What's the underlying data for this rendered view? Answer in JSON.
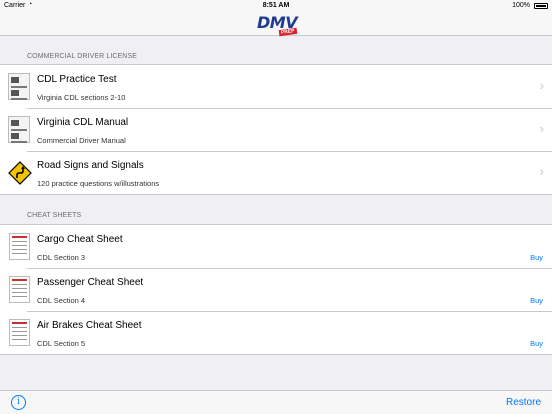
{
  "status_bar": {
    "carrier": "Carrier",
    "wifi_icon": "wifi-icon",
    "time": "8:51 AM",
    "battery": "100%"
  },
  "nav": {
    "logo_text": "DMV",
    "logo_badge": "PREP"
  },
  "sections": [
    {
      "header": "COMMERCIAL DRIVER LICENSE",
      "rows": [
        {
          "title": "CDL Practice Test",
          "subtitle": "Virginia CDL sections 2-10",
          "icon": "test-thumbnail-icon"
        },
        {
          "title": "Virginia CDL Manual",
          "subtitle": "Commercial Driver Manual",
          "icon": "manual-thumbnail-icon"
        },
        {
          "title": "Road Signs and Signals",
          "subtitle": "120 practice questions w/illustrations",
          "icon": "winding-road-sign-icon"
        }
      ]
    },
    {
      "header": "CHEAT SHEETS",
      "rows": [
        {
          "title": "Cargo Cheat Sheet",
          "subtitle": "CDL Section 3",
          "action": "Buy",
          "icon": "cheat-sheet-thumbnail-icon"
        },
        {
          "title": "Passenger Cheat Sheet",
          "subtitle": "CDL Section 4",
          "action": "Buy",
          "icon": "cheat-sheet-thumbnail-icon"
        },
        {
          "title": "Air Brakes Cheat Sheet",
          "subtitle": "CDL Section 5",
          "action": "Buy",
          "icon": "cheat-sheet-thumbnail-icon"
        }
      ]
    }
  ],
  "toolbar": {
    "info_label": "i",
    "restore_label": "Restore"
  },
  "colors": {
    "accent": "#007aff",
    "background": "#efeff4",
    "logo_blue": "#1f3c8f",
    "logo_red": "#d6202a",
    "sign_yellow": "#f5c400"
  }
}
